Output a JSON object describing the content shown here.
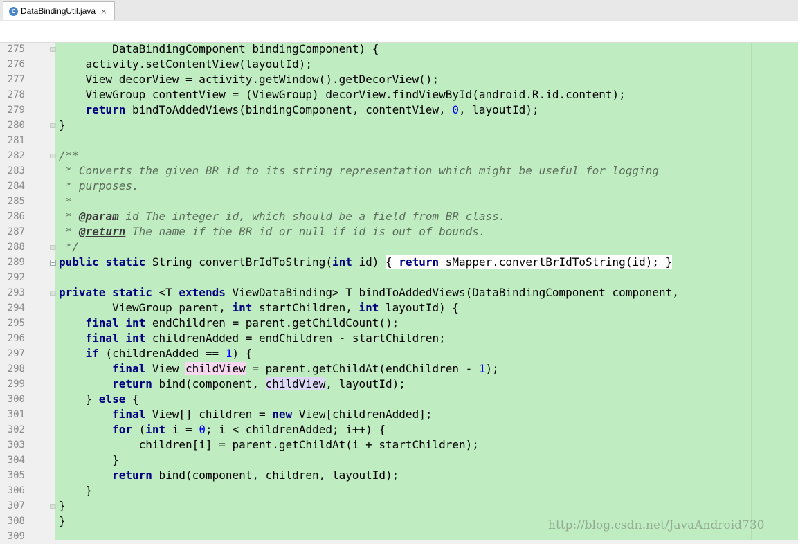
{
  "tab": {
    "filename": "DataBindingUtil.java",
    "close": "×",
    "file_icon": "java-class-icon"
  },
  "gutter": {
    "lines": [
      "275",
      "276",
      "277",
      "278",
      "279",
      "280",
      "281",
      "282",
      "283",
      "284",
      "285",
      "286",
      "287",
      "288",
      "289",
      "292",
      "293",
      "294",
      "295",
      "296",
      "297",
      "298",
      "299",
      "300",
      "301",
      "302",
      "303",
      "304",
      "305",
      "306",
      "307",
      "308",
      "309"
    ]
  },
  "code": {
    "l275_0": "        DataBindingComponent bindingComponent) {",
    "l276_0": "    activity.setContentView(layoutId);",
    "l277_0": "    View decorView = activity.getWindow().getDecorView();",
    "l278_0": "    ViewGroup contentView = (ViewGroup) decorView.findViewById(android.R.id.content);",
    "l279_0": "    ",
    "l279_kw": "return",
    "l279_1": " bindToAddedViews(bindingComponent, contentView, ",
    "l279_n": "0",
    "l279_2": ", layoutId);",
    "l280_0": "}",
    "l282_d": "/**",
    "l283_d": " * Converts the given BR id to its string representation which might be useful for logging",
    "l284_d": " * purposes.",
    "l285_d": " *",
    "l286_d1": " * ",
    "l286_t": "@param",
    "l286_d2": " id The integer id, which should be a field from BR class.",
    "l287_d1": " * ",
    "l287_t": "@return",
    "l287_d2": " The name if the BR id or null if id is out of bounds.",
    "l288_d": " */",
    "l289_kw1": "public",
    "l289_s1": " ",
    "l289_kw2": "static",
    "l289_a": " String convertBrIdToString(",
    "l289_kw3": "int",
    "l289_b": " id)",
    "l289_c": " ",
    "l289_f1": "{ ",
    "l289_kw4": "return",
    "l289_d": " sMapper.convertBrIdToString(id);",
    "l289_f2": " }",
    "l293_kw1": "private",
    "l293_s1": " ",
    "l293_kw2": "static",
    "l293_a": " <T ",
    "l293_kw3": "extends",
    "l293_b": " ViewDataBinding> T bindToAddedViews(DataBindingComponent component,",
    "l294_a": "        ViewGroup parent, ",
    "l294_kw1": "int",
    "l294_b": " startChildren, ",
    "l294_kw2": "int",
    "l294_c": " layoutId) {",
    "l295_a": "    ",
    "l295_kw1": "final",
    "l295_s": " ",
    "l295_kw2": "int",
    "l295_b": " endChildren = parent.getChildCount();",
    "l296_a": "    ",
    "l296_kw1": "final",
    "l296_s": " ",
    "l296_kw2": "int",
    "l296_b": " childrenAdded = endChildren - startChildren;",
    "l297_a": "    ",
    "l297_kw": "if",
    "l297_b": " (childrenAdded == ",
    "l297_n": "1",
    "l297_c": ") {",
    "l298_a": "        ",
    "l298_kw": "final",
    "l298_b": " View ",
    "l298_v": "childView",
    "l298_c": " = parent.getChildAt(endChildren - ",
    "l298_n": "1",
    "l298_d": ");",
    "l299_a": "        ",
    "l299_kw": "return",
    "l299_b": " bind(component, ",
    "l299_v": "childView",
    "l299_c": ", layoutId);",
    "l300_a": "    } ",
    "l300_kw": "else",
    "l300_b": " {",
    "l301_a": "        ",
    "l301_kw1": "final",
    "l301_b": " View[] children = ",
    "l301_kw2": "new",
    "l301_c": " View[childrenAdded];",
    "l302_a": "        ",
    "l302_kw1": "for",
    "l302_b": " (",
    "l302_kw2": "int",
    "l302_c": " i = ",
    "l302_n": "0",
    "l302_d": "; i < childrenAdded; i++) {",
    "l303_a": "            children[i] = parent.getChildAt(i + startChildren);",
    "l304_a": "        }",
    "l305_a": "        ",
    "l305_kw": "return",
    "l305_b": " bind(component, children, layoutId);",
    "l306_a": "    }",
    "l307_a": "}",
    "l308_a": "}"
  },
  "watermark": "http://blog.csdn.net/JavaAndroid730",
  "colors": {
    "editor_bg": "#c0ecc1",
    "keyword": "#000080",
    "number": "#0000ff",
    "doc_comment": "#5c6e5c"
  }
}
